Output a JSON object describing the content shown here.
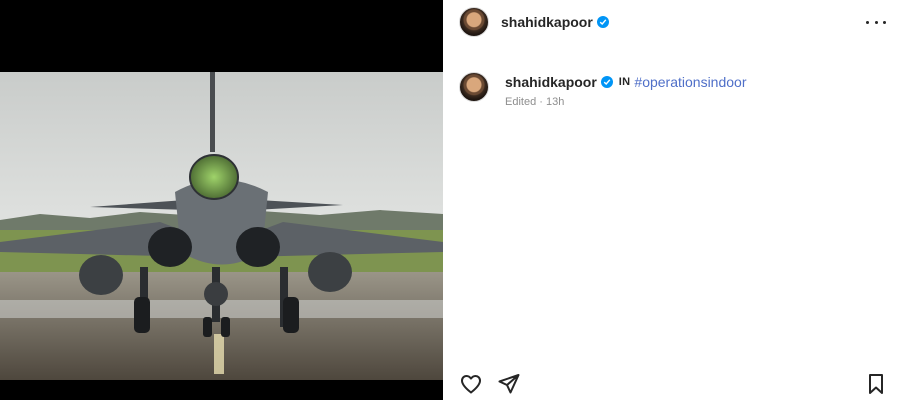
{
  "post": {
    "username": "shahidkapoor",
    "verified": true,
    "caption": {
      "username": "shahidkapoor",
      "in_label": "IN",
      "hashtag": "#operationsindoor",
      "edited": "Edited",
      "separator": "·",
      "time": "13h"
    }
  },
  "icons": {
    "more": "more-options-icon",
    "like": "heart-icon",
    "share": "paper-plane-icon",
    "save": "bookmark-icon",
    "verified": "verified-badge-icon"
  },
  "colors": {
    "link": "#4f6fc8",
    "verified": "#0095f6",
    "muted": "#8e8e8e",
    "text": "#262626"
  }
}
